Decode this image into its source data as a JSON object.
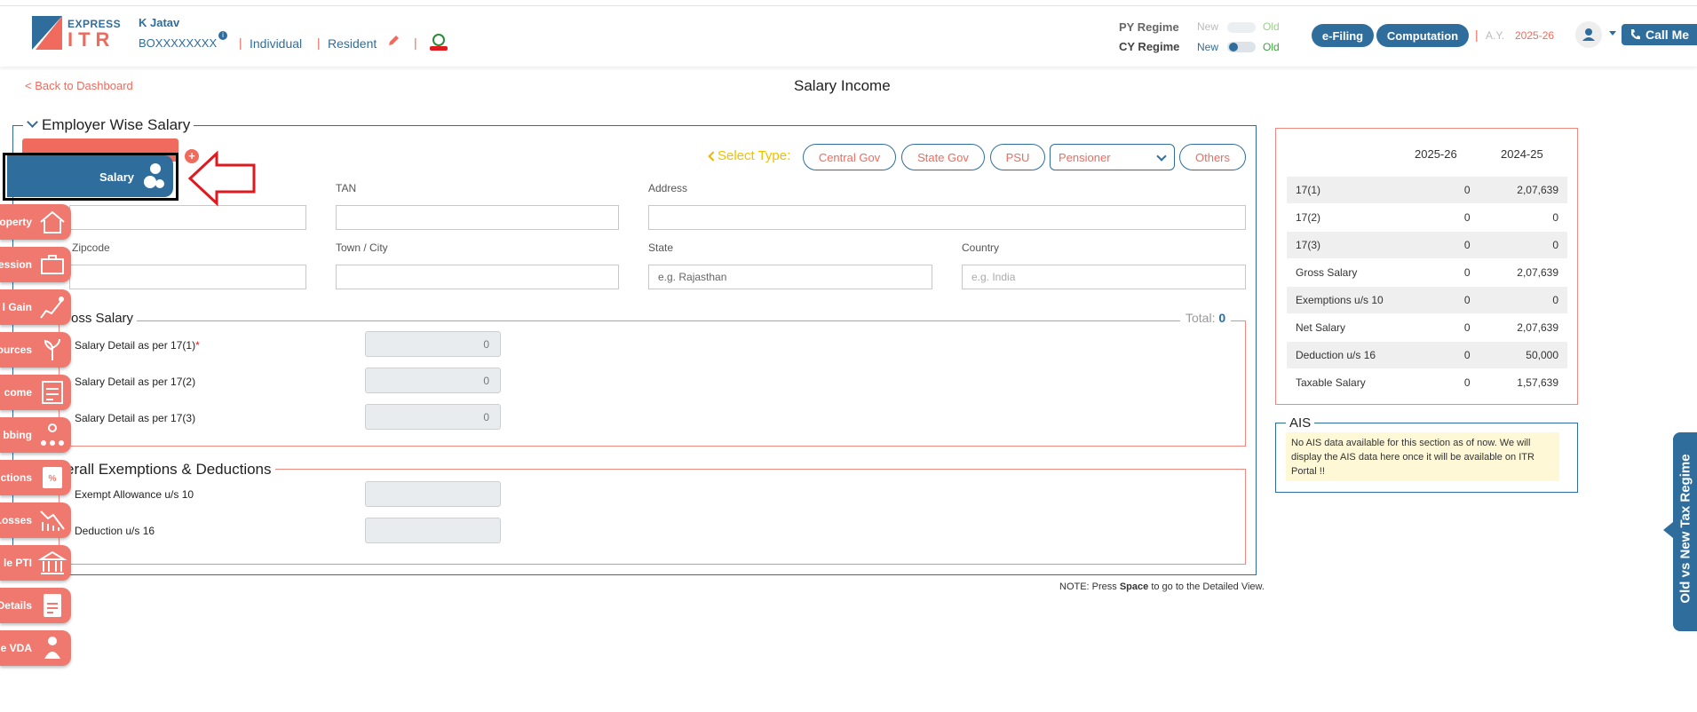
{
  "header": {
    "logo_top": "EXPRESS",
    "logo_bottom": "ITR",
    "user_name": "K Jatav",
    "pan": "BOXXXXXXXX",
    "status": "Individual",
    "residency": "Resident",
    "py_regime_label": "PY Regime",
    "cy_regime_label": "CY Regime",
    "new": "New",
    "old": "Old",
    "efiling": "e-Filing",
    "computation": "Computation",
    "ay_label": "A.Y.",
    "ay_value": "2025-26",
    "call_me": "Call Me"
  },
  "page": {
    "back": "< Back to Dashboard",
    "title": "Salary Income",
    "note_prefix": "NOTE: Press ",
    "note_key": "Space",
    "note_suffix": " to go to the Detailed View."
  },
  "employer": {
    "legend": "Employer Wise Salary",
    "select_type_label": "Select Type:",
    "types": [
      "Central Gov",
      "State Gov",
      "PSU",
      "Others"
    ],
    "pensioner_option": "Pensioner",
    "tan_label": "TAN",
    "address_label": "Address",
    "zipcode_label": "Zipcode",
    "town_label": "Town / City",
    "state_label": "State",
    "state_placeholder": "e.g. Rajasthan",
    "country_label": "Country",
    "country_placeholder": "e.g. India"
  },
  "gross": {
    "legend": "oss Salary",
    "total_label": "Total:",
    "total_value": "0",
    "rows": [
      {
        "label": "Salary Detail as per 17(1)",
        "required": "*",
        "value": "0"
      },
      {
        "label": "Salary Detail as per 17(2)",
        "value": "0"
      },
      {
        "label": "Salary Detail as per 17(3)",
        "value": "0"
      }
    ]
  },
  "exemptions": {
    "legend": "erall Exemptions & Deductions",
    "rows": [
      {
        "label": "Exempt Allowance u/s 10"
      },
      {
        "label": "Deduction u/s 16"
      }
    ]
  },
  "sidebar": {
    "active": "Salary",
    "items": [
      "operty",
      "ession",
      "l Gain",
      "ources",
      "come",
      "bbing",
      "ctions",
      "Losses",
      "le PTI",
      "Details",
      "le VDA"
    ]
  },
  "summary": {
    "year1": "2025-26",
    "year2": "2024-25",
    "rows": [
      {
        "label": "17(1)",
        "y1": "0",
        "y2": "2,07,639"
      },
      {
        "label": "17(2)",
        "y1": "0",
        "y2": "0"
      },
      {
        "label": "17(3)",
        "y1": "0",
        "y2": "0"
      },
      {
        "label": "Gross Salary",
        "y1": "0",
        "y2": "2,07,639"
      },
      {
        "label": "Exemptions u/s 10",
        "y1": "0",
        "y2": "0"
      },
      {
        "label": "Net Salary",
        "y1": "0",
        "y2": "2,07,639"
      },
      {
        "label": "Deduction u/s 16",
        "y1": "0",
        "y2": "50,000"
      },
      {
        "label": "Taxable Salary",
        "y1": "0",
        "y2": "1,57,639"
      }
    ]
  },
  "ais": {
    "legend": "AIS",
    "message": "No AIS data available for this section as of now. We will display the AIS data here once it will be available on ITR Portal !!"
  },
  "side_panel": {
    "label": "Old vs New Tax Regime"
  },
  "colors": {
    "primary": "#2f6e9c",
    "accent": "#f06b5e",
    "highlight_red": "#e0191e"
  }
}
